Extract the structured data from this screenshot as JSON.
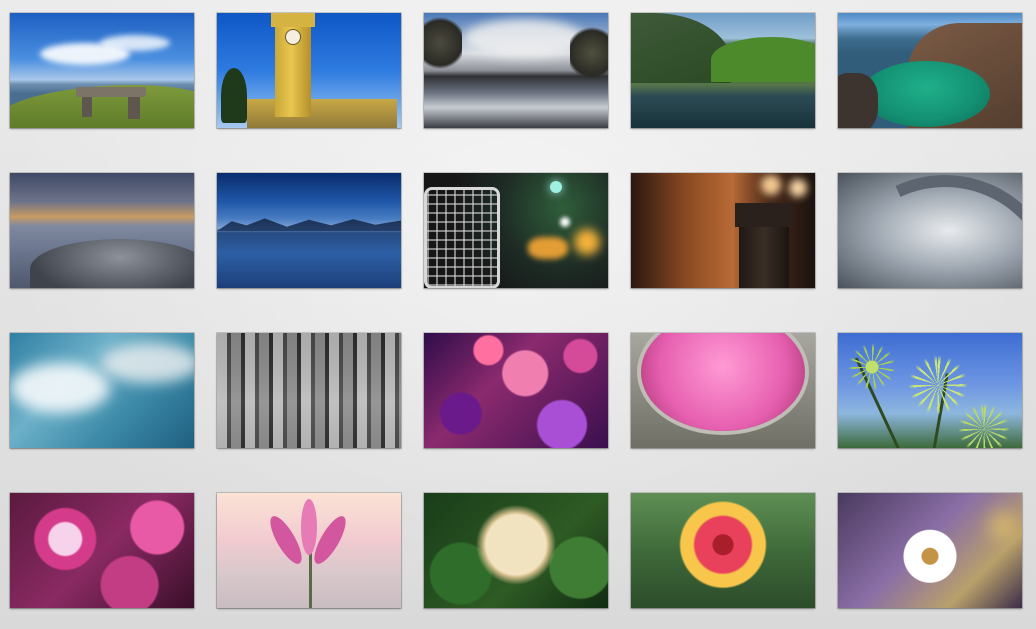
{
  "gallery": {
    "thumbnails": [
      {
        "id": "wallpaper-coastal-bench",
        "icon": "coastal-cliff-photo"
      },
      {
        "id": "wallpaper-clock-tower",
        "icon": "clock-tower-photo"
      },
      {
        "id": "wallpaper-river-reflection",
        "icon": "river-reflection-photo"
      },
      {
        "id": "wallpaper-green-lake",
        "icon": "mountain-lake-photo"
      },
      {
        "id": "wallpaper-emerald-lagoon",
        "icon": "lagoon-photo"
      },
      {
        "id": "wallpaper-dusk-shore",
        "icon": "rocky-shore-photo"
      },
      {
        "id": "wallpaper-blue-mountains",
        "icon": "blue-mountains-photo"
      },
      {
        "id": "wallpaper-bike-basket-bokeh",
        "icon": "bike-basket-photo"
      },
      {
        "id": "wallpaper-post-bokeh",
        "icon": "wooden-post-photo"
      },
      {
        "id": "wallpaper-gateway-arch",
        "icon": "arch-photo"
      },
      {
        "id": "wallpaper-blue-clouds",
        "icon": "clouds-photo"
      },
      {
        "id": "wallpaper-3d-cubes",
        "icon": "cubes-photo"
      },
      {
        "id": "wallpaper-mixed-flowers",
        "icon": "flowers-photo"
      },
      {
        "id": "wallpaper-pink-pot",
        "icon": "pink-flowers-photo"
      },
      {
        "id": "wallpaper-umbel-sky",
        "icon": "plant-sky-photo"
      },
      {
        "id": "wallpaper-dianthus",
        "icon": "dianthus-photo"
      },
      {
        "id": "wallpaper-pink-lily",
        "icon": "lily-photo"
      },
      {
        "id": "wallpaper-hydrangea",
        "icon": "hydrangea-photo"
      },
      {
        "id": "wallpaper-gaillardia",
        "icon": "gaillardia-photo"
      },
      {
        "id": "wallpaper-daisy",
        "icon": "daisy-photo"
      }
    ]
  },
  "colors": {
    "background": "#e6e6e6",
    "thumbnail_border": "#00000026"
  }
}
